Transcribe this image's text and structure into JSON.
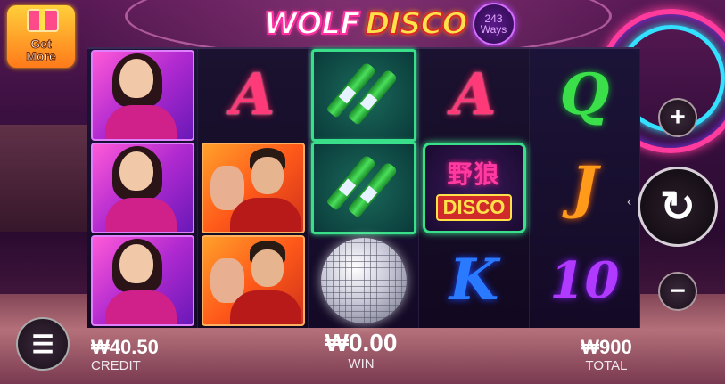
{
  "game": {
    "logo_word1": "WOLF",
    "logo_word2": "DISCO",
    "ways_number": "243",
    "ways_label": "Ways"
  },
  "promo": {
    "get_more_label": "Get\nMore"
  },
  "reels": [
    [
      "woman",
      "woman",
      "woman"
    ],
    [
      "A",
      "man",
      "man"
    ],
    [
      "beer",
      "beer",
      "disco-ball"
    ],
    [
      "A",
      "wild-disco",
      "K"
    ],
    [
      "Q",
      "J",
      "10"
    ]
  ],
  "symbols": {
    "A": "A",
    "K": "K",
    "Q": "Q",
    "J": "J",
    "10": "10",
    "wild_cjk": "野狼",
    "wild_word": "DISCO"
  },
  "controls": {
    "plus_icon": "+",
    "minus_icon": "−",
    "spin_icon": "↻",
    "menu_icon": "☰",
    "spin_hint": "‹"
  },
  "meters": {
    "credit_value": "₩40.50",
    "credit_label": "CREDIT",
    "win_value": "₩0.00",
    "win_label": "WIN",
    "total_value": "₩900",
    "total_label": "TOTAL"
  },
  "colors": {
    "accent_pink": "#ff3b9d",
    "accent_green": "#3adf8a",
    "accent_gold": "#ffe14a"
  }
}
